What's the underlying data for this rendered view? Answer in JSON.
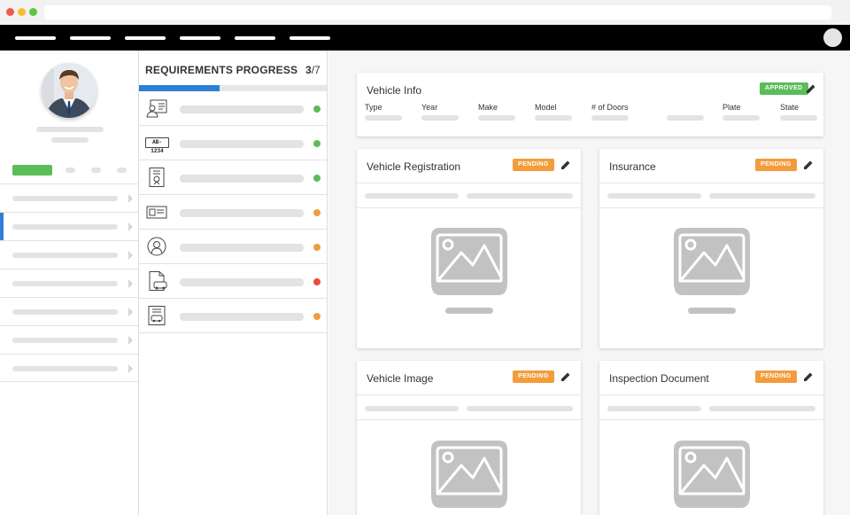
{
  "colors": {
    "accent": "#2f7fd8",
    "status_green": "#5bbd5a",
    "status_orange": "#f39c3c",
    "status_red": "#e84c3d",
    "nav_bg": "#000000"
  },
  "topnav": {
    "item_count": 6
  },
  "sidebar": {
    "active_index": 1,
    "row_count": 7
  },
  "requirements": {
    "title": "REQUIREMENTS PROGRESS",
    "count_done": "3",
    "count_total": "/7",
    "progress": 0.4286,
    "items": [
      {
        "icon": "id-card-person-icon",
        "status": "green"
      },
      {
        "icon": "license-plate-icon",
        "plate_text": "AB-1234",
        "status": "green"
      },
      {
        "icon": "certificate-icon",
        "status": "green"
      },
      {
        "icon": "card-icon",
        "status": "orange"
      },
      {
        "icon": "person-badge-icon",
        "status": "orange"
      },
      {
        "icon": "car-document-icon",
        "status": "red"
      },
      {
        "icon": "vehicle-document-icon",
        "status": "orange"
      }
    ]
  },
  "vehicle_info": {
    "title": "Vehicle Info",
    "badge": "APPROVED",
    "columns": [
      "Type",
      "Year",
      "Make",
      "Model",
      "# of Doors",
      "",
      "Plate",
      "State"
    ]
  },
  "cards": [
    {
      "title": "Vehicle Registration",
      "badge": "PENDING"
    },
    {
      "title": "Insurance",
      "badge": "PENDING"
    },
    {
      "title": "Vehicle Image",
      "badge": "PENDING"
    },
    {
      "title": "Inspection Document",
      "badge": "PENDING"
    }
  ]
}
